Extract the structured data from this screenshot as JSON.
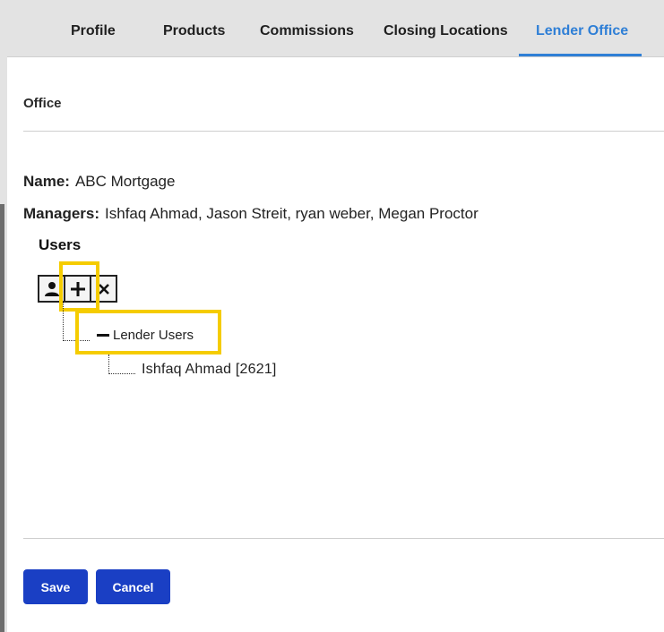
{
  "tabs": [
    {
      "label": "Profile"
    },
    {
      "label": "Products"
    },
    {
      "label": "Commissions"
    },
    {
      "label": "Closing Locations"
    },
    {
      "label": "Lender Office",
      "active": true
    }
  ],
  "section": {
    "title": "Office"
  },
  "office": {
    "name_label": "Name:",
    "name_value": "ABC Mortgage",
    "managers_label": "Managers:",
    "managers_value": "Ishfaq Ahmad, Jason Streit, ryan weber, Megan Proctor"
  },
  "users": {
    "title": "Users",
    "toolbar": [
      {
        "icon": "user-icon"
      },
      {
        "icon": "plus-icon"
      },
      {
        "icon": "close-icon"
      }
    ],
    "tree": {
      "group_label": "Lender Users",
      "children": [
        "Ishfaq Ahmad [2621]"
      ]
    }
  },
  "actions": {
    "save_label": "Save",
    "cancel_label": "Cancel"
  },
  "colors": {
    "accent": "#2f7fd6",
    "button": "#1a3fc4",
    "highlight": "#f5cc00",
    "tabbar": "#e3e3e3"
  }
}
